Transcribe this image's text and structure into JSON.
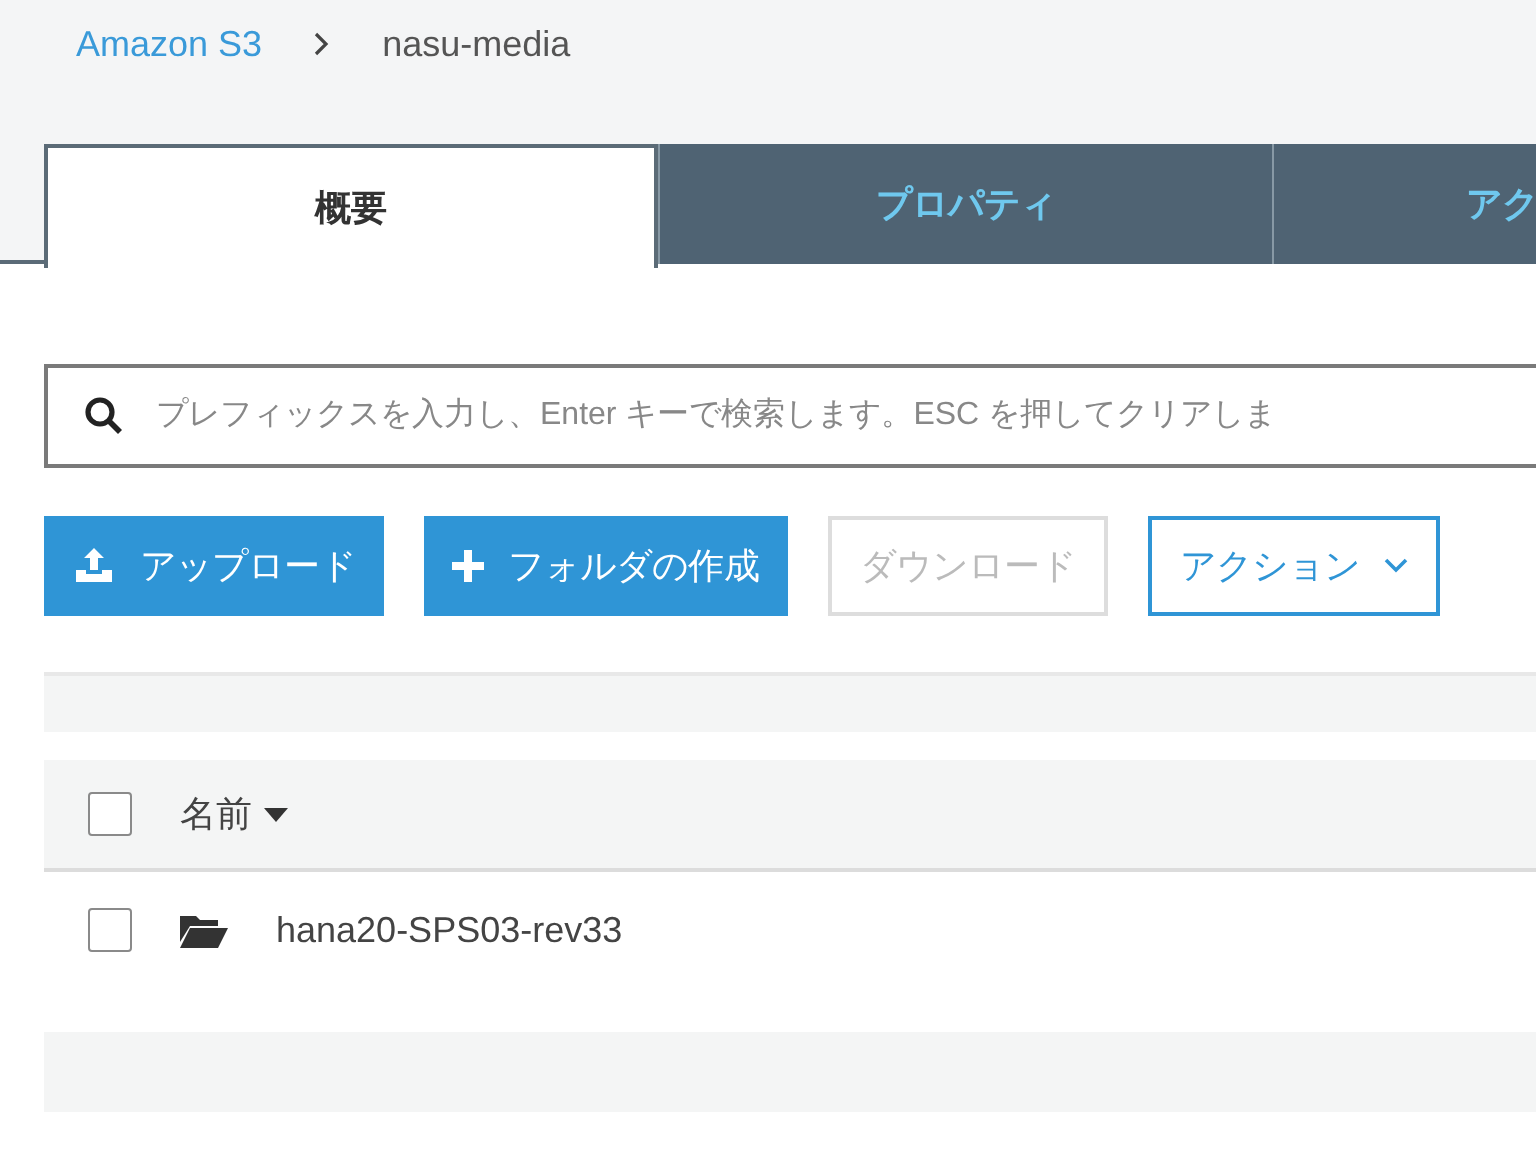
{
  "breadcrumb": [
    {
      "label": "Amazon S3",
      "kind": "link"
    },
    {
      "label": "nasu-media",
      "kind": "current"
    }
  ],
  "tabs": [
    {
      "label": "概要",
      "selected": true
    },
    {
      "label": "プロパティ",
      "selected": false
    },
    {
      "label": "アク",
      "selected": false
    }
  ],
  "search": {
    "placeholder": "プレフィックスを入力し、Enter キーで検索します。ESC を押してクリアしま"
  },
  "buttons": [
    {
      "label": "アップロード",
      "kind": "upload",
      "disabled": false
    },
    {
      "label": "フォルダの作成",
      "kind": "create",
      "disabled": false
    },
    {
      "label": "ダウンロード",
      "kind": "plain",
      "disabled": true
    },
    {
      "label": "アクション",
      "kind": "dropdown",
      "disabled": false
    }
  ],
  "table": {
    "header": {
      "label": "名前",
      "checked": false
    },
    "rows": [
      {
        "name": "hana20-SPS03-rev33",
        "checked": false
      }
    ]
  }
}
